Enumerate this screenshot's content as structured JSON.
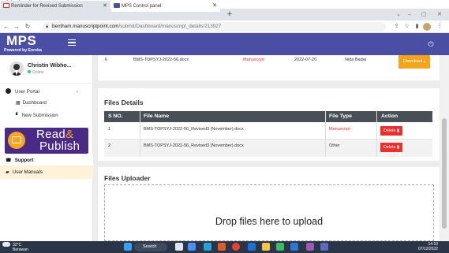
{
  "caption": "This is the screenshot:",
  "browser": {
    "tabs": [
      {
        "label": "Reminder for Revised Submission",
        "icon": "gmail-icon"
      },
      {
        "label": "MPS Control panel",
        "icon": "mps-icon"
      }
    ],
    "new_tab": "+",
    "url_host": "bentham.manuscriptpoint.com",
    "url_path": "/submit/Dashboard/manuscript_details/213927"
  },
  "app": {
    "brand": "MPS",
    "brand_sub": "Powered by Eureka"
  },
  "sidebar": {
    "user_name": "Christin Wibho...",
    "user_status": "Online",
    "user_portal": "User Portal",
    "dashboard": "Dashboard",
    "new_submission": "New Submission",
    "read_line1": "Read",
    "read_amp": "&",
    "read_line2": "Publish",
    "support": "Support",
    "user_manuals": "User Manuals"
  },
  "top_row": {
    "sno": "6",
    "file_name": "BMS-TOPSYJ-2022-56.docx",
    "file_type": "Manuscript",
    "date": "2022-07-20",
    "uploader": "Nida Badar",
    "action": "Download"
  },
  "files_details": {
    "title": "Files Details",
    "headers": [
      "S NO.",
      "File Name",
      "File Type",
      "Action"
    ],
    "rows": [
      {
        "sno": "1",
        "file_name": "BMS-TOPSYJ-2022-56_Revised3 (November).docx",
        "file_type": "Manuscript",
        "action": "Delete"
      },
      {
        "sno": "2",
        "file_name": "BMS-TOPSYJ-2022-56_Revised3 (November).docx",
        "file_type": "Other",
        "action": "Delete"
      }
    ]
  },
  "files_uploader": {
    "title": "Files Uploader",
    "drop_text": "Drop files here to upload"
  },
  "taskbar": {
    "temp": "32°C",
    "weather": "Berawan",
    "search": "Search",
    "time": "14:10",
    "date": "07/12/2022"
  },
  "colors": {
    "brand": "#4a4fa3",
    "download": "#f5a31a",
    "delete": "#e8302f",
    "manuscript_text": "#e8302f",
    "table_header": "#494f56"
  }
}
